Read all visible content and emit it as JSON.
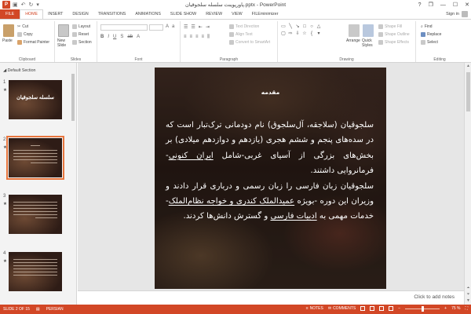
{
  "app": {
    "title": "پاورپوینت سلسله سلجوقیان.pptx - PowerPoint",
    "logo_letter": "P",
    "sign_in": "Sign in",
    "accent": "#d24726"
  },
  "qat": {
    "save_icon": "save-icon",
    "undo_icon": "undo-icon",
    "redo_icon": "redo-icon"
  },
  "window_controls": {
    "help": "?",
    "restore_ribbon": "❐",
    "minimize": "—",
    "maximize": "☐",
    "close": "✕"
  },
  "tabs": [
    "FILE",
    "HOME",
    "INSERT",
    "DESIGN",
    "TRANSITIONS",
    "ANIMATIONS",
    "SLIDE SHOW",
    "REVIEW",
    "VIEW",
    "FILEminimizer"
  ],
  "active_tab": "HOME",
  "ribbon": {
    "clipboard": {
      "label": "Clipboard",
      "paste": "Paste",
      "cut": "Cut",
      "copy": "Copy",
      "format_painter": "Format Painter"
    },
    "slides": {
      "label": "Slides",
      "new_slide_line1": "New",
      "new_slide_line2": "Slide",
      "layout": "Layout",
      "reset": "Reset",
      "section": "Section"
    },
    "font": {
      "label": "Font"
    },
    "paragraph": {
      "label": "Paragraph",
      "text_direction": "Text Direction",
      "align_text": "Align Text",
      "convert_smartart": "Convert to SmartArt"
    },
    "drawing": {
      "label": "Drawing",
      "arrange": "Arrange",
      "quick_styles_line1": "Quick",
      "quick_styles_line2": "Styles",
      "shape_fill": "Shape Fill",
      "shape_outline": "Shape Outline",
      "shape_effects": "Shape Effects"
    },
    "editing": {
      "label": "Editing",
      "find": "Find",
      "replace": "Replace",
      "select": "Select"
    }
  },
  "thumbnails": {
    "section_header": "Default Section",
    "items": [
      {
        "number": "1",
        "title": "سلسله سلجوقیان",
        "selected": false
      },
      {
        "number": "2",
        "title": "",
        "selected": true
      },
      {
        "number": "3",
        "title": "",
        "selected": false
      },
      {
        "number": "4",
        "title": "",
        "selected": false
      }
    ]
  },
  "slide": {
    "title": "مقدمه",
    "body": {
      "p1": "سلجوقیان (سلاجقه، آل‌سلجوق) نام دودمانی ترک‌تبار است که در سده‌های پنجم و ششم هجری (یازدهم و دوازدهم میلادی) بر بخش‌های بزرگی از آسیای غربی-شامل ",
      "p1_u": "ایران کنونی",
      "p1_end": "- فرمانروایی داشتند.",
      "p2": "سلجوقیان زبان فارسی را زبان رسمی و درباری قرار دادند و وزیران این دوره -بویژه ",
      "p2_u": "عمیدالملک کندری و خواجه نظام‌الملک",
      "p2_mid": "- خدمات مهمی به ",
      "p2_u2": "ادبیات فارسی",
      "p2_end": " و گسترش دانش‌ها کردند."
    }
  },
  "notes": {
    "placeholder": "Click to add notes"
  },
  "status": {
    "slide_info": "SLIDE 2 OF 15",
    "language": "PERSIAN",
    "notes_btn": "NOTES",
    "comments_btn": "COMMENTS",
    "zoom": "75 %",
    "zoom_level": 0.5
  }
}
